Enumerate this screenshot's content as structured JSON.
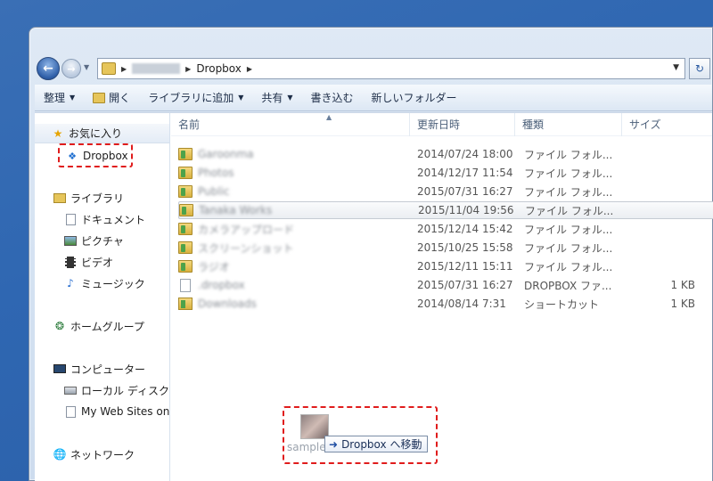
{
  "address": {
    "segments": [
      "Dropbox"
    ],
    "back_icon": "back-arrow-icon",
    "forward_icon": "forward-arrow-icon",
    "refresh_icon": "refresh-icon"
  },
  "toolbar": {
    "organize": "整理",
    "open": "開く",
    "add_library": "ライブラリに追加",
    "share": "共有",
    "burn": "書き込む",
    "new_folder": "新しいフォルダー"
  },
  "nav": {
    "favorites": "お気に入り",
    "dropbox": "Dropbox",
    "libraries": "ライブラリ",
    "documents": "ドキュメント",
    "pictures": "ピクチャ",
    "videos": "ビデオ",
    "music": "ミュージック",
    "homegroup": "ホームグループ",
    "computer": "コンピューター",
    "local_disk": "ローカル ディスク",
    "web_sites": "My Web Sites on",
    "network": "ネットワーク"
  },
  "columns": {
    "name": "名前",
    "date": "更新日時",
    "type": "種類",
    "size": "サイズ"
  },
  "files": [
    {
      "name": "Garoonma",
      "date": "2014/07/24 18:00",
      "type": "ファイル フォル...",
      "size": "",
      "icon": "folder-icon"
    },
    {
      "name": "Photos",
      "date": "2014/12/17 11:54",
      "type": "ファイル フォル...",
      "size": "",
      "icon": "folder-icon"
    },
    {
      "name": "Public",
      "date": "2015/07/31 16:27",
      "type": "ファイル フォル...",
      "size": "",
      "icon": "folder-icon"
    },
    {
      "name": "Tanaka Works",
      "date": "2015/11/04 19:56",
      "type": "ファイル フォル...",
      "size": "",
      "icon": "folder-icon",
      "selected": true
    },
    {
      "name": "カメラアップロード",
      "date": "2015/12/14 15:42",
      "type": "ファイル フォル...",
      "size": "",
      "icon": "folder-icon"
    },
    {
      "name": "スクリーンショット",
      "date": "2015/10/25 15:58",
      "type": "ファイル フォル...",
      "size": "",
      "icon": "folder-icon"
    },
    {
      "name": "ラジオ",
      "date": "2015/12/11 15:11",
      "type": "ファイル フォル...",
      "size": "",
      "icon": "folder-icon"
    },
    {
      "name": ".dropbox",
      "date": "2015/07/31 16:27",
      "type": "DROPBOX ファ...",
      "size": "1 KB",
      "icon": "file-icon"
    },
    {
      "name": "Downloads",
      "date": "2014/08/14 7:31",
      "type": "ショートカット",
      "size": "1 KB",
      "icon": "shortcut-icon"
    }
  ],
  "drag": {
    "label": "sample",
    "tooltip": "Dropbox へ移動"
  }
}
